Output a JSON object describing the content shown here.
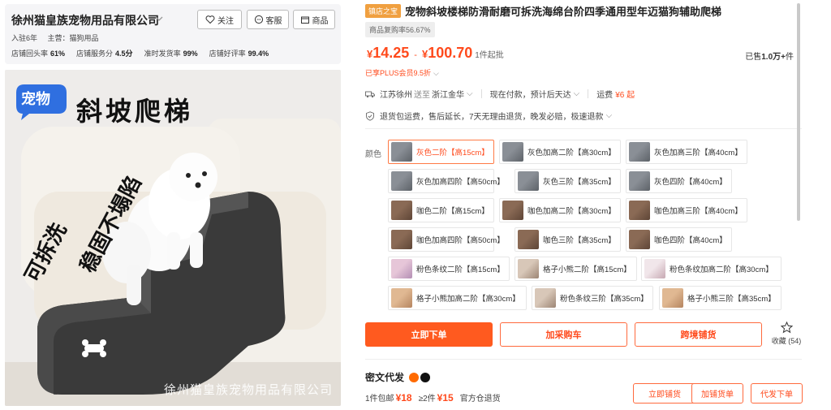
{
  "shop": {
    "name": "徐州猫皇族宠物用品有限公司",
    "follow_label": "关注",
    "service_label": "客服",
    "goods_label": "商品",
    "years": "入驻6年",
    "main_business": "主营：猫狗用品",
    "stats": [
      {
        "label": "店铺回头率",
        "value": "61%"
      },
      {
        "label": "店铺服务分",
        "value": "4.5分"
      },
      {
        "label": "准时发货率",
        "value": "99%"
      },
      {
        "label": "店铺好评率",
        "value": "99.4%"
      }
    ]
  },
  "image": {
    "badge": "宠物",
    "headline": "斜坡爬梯",
    "slogan_1": "可拆洗",
    "slogan_2": "稳固不塌陷",
    "watermark": "徐州猫皇族宠物用品有限公司"
  },
  "product": {
    "store_badge": "镇店之宝",
    "title": "宠物斜坡楼梯防滑耐磨可拆洗海绵台阶四季通用型年迈猫狗辅助爬梯",
    "rebuy": "商品复购率56.67%",
    "price_symbol": "¥",
    "price_low": "14.25",
    "price_sep": "-",
    "price_high": "100.70",
    "min_order": "1件起批",
    "sold_prefix": "已售",
    "sold_value": "1.0万+",
    "sold_unit": "件",
    "plus_text": "已享PLUS会员9.5折"
  },
  "shipping": {
    "origin": "江苏徐州",
    "to_label": "送至",
    "destination": "浙江金华",
    "payment": "现在付款，预计后天达",
    "fee_label": "运费",
    "fee_value": "¥6 起"
  },
  "guarantee": {
    "text": "退货包运费，售后延长，7天无理由退货，晚发必赔，极速退款"
  },
  "colors": {
    "label": "颜色",
    "options": [
      {
        "label": "灰色二阶【高15cm】",
        "selected": true,
        "tone": "gray"
      },
      {
        "label": "灰色加高二阶【高30cm】",
        "selected": false,
        "tone": "gray"
      },
      {
        "label": "灰色加高三阶【高40cm】",
        "selected": false,
        "tone": "gray"
      },
      {
        "label": "灰色加高四阶【高50cm】",
        "selected": false,
        "tone": "gray"
      },
      {
        "label": "灰色三阶【高35cm】",
        "selected": false,
        "tone": "gray"
      },
      {
        "label": "灰色四阶【高40cm】",
        "selected": false,
        "tone": "gray"
      },
      {
        "label": "咖色二阶【高15cm】",
        "selected": false,
        "tone": "brown"
      },
      {
        "label": "咖色加高二阶【高30cm】",
        "selected": false,
        "tone": "brown"
      },
      {
        "label": "咖色加高三阶【高40cm】",
        "selected": false,
        "tone": "brown"
      },
      {
        "label": "咖色加高四阶【高50cm】",
        "selected": false,
        "tone": "brown"
      },
      {
        "label": "咖色三阶【高35cm】",
        "selected": false,
        "tone": "brown"
      },
      {
        "label": "咖色四阶【高40cm】",
        "selected": false,
        "tone": "brown"
      },
      {
        "label": "粉色条纹二阶【高15cm】",
        "selected": false,
        "tone": "pink"
      },
      {
        "label": "格子小熊二阶【高15cm】",
        "selected": false,
        "tone": "plaid"
      },
      {
        "label": "粉色条纹加高二阶【高30cm】",
        "selected": false,
        "tone": "pinkwhite"
      },
      {
        "label": "格子小熊加高二阶【高30cm】",
        "selected": false,
        "tone": "tan"
      },
      {
        "label": "粉色条纹三阶【高35cm】",
        "selected": false,
        "tone": "plaid"
      },
      {
        "label": "格子小熊三阶【高35cm】",
        "selected": false,
        "tone": "tan"
      }
    ]
  },
  "actions": {
    "buy_now": "立即下单",
    "add_cart": "加采购车",
    "cross_border": "跨境铺货",
    "collect": "收藏 (54)"
  },
  "dropship": {
    "title": "密文代发",
    "text_1": "1件包邮",
    "price_1": "¥18",
    "text_2": "≥2件",
    "price_2": "¥15",
    "text_3": "官方仓退货",
    "btn_list": "立即铺货",
    "btn_add": "加铺货单",
    "btn_order": "代发下单"
  },
  "theme": {
    "accent": "#ff4a1c",
    "accent_button": "#ff5a1f",
    "badge": "#f0a040"
  }
}
